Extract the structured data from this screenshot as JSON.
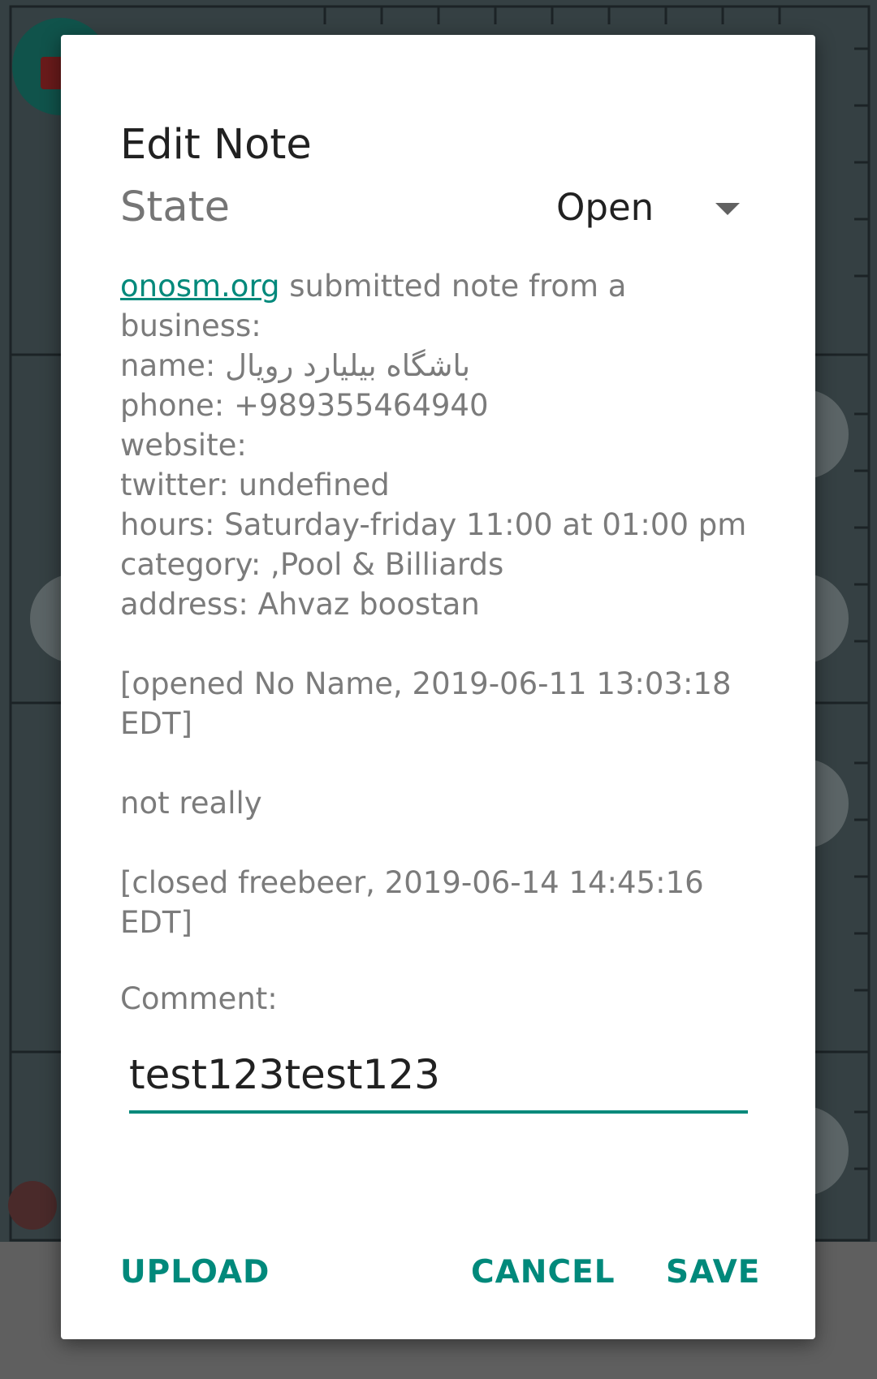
{
  "dialog": {
    "title": "Edit Note",
    "state_label": "State",
    "state_value": "Open",
    "note": {
      "link_text": "onosm.org",
      "intro_rest": " submitted note from a business:",
      "name_label": "name: ",
      "name_value": "باشگاه بیلیارد رویال",
      "phone": "phone: +989355464940",
      "website": "website:",
      "twitter": "twitter: undefined",
      "hours": "hours: Saturday-friday 11:00 at 01:00 pm",
      "category": "category: ,Pool & Billiards",
      "address": "address: Ahvaz boostan",
      "opened": "[opened No Name, 2019-06-11 13:03:18 EDT]",
      "comment_text": "not really",
      "closed": "[closed freebeer, 2019-06-14 14:45:16 EDT]"
    },
    "comment_label": "Comment:",
    "comment_value": "test123test123",
    "buttons": {
      "upload": "UPLOAD",
      "cancel": "CANCEL",
      "save": "SAVE"
    }
  },
  "colors": {
    "accent": "#00897b",
    "scrim": "#3b4446",
    "dialog_bg": "#ffffff"
  }
}
